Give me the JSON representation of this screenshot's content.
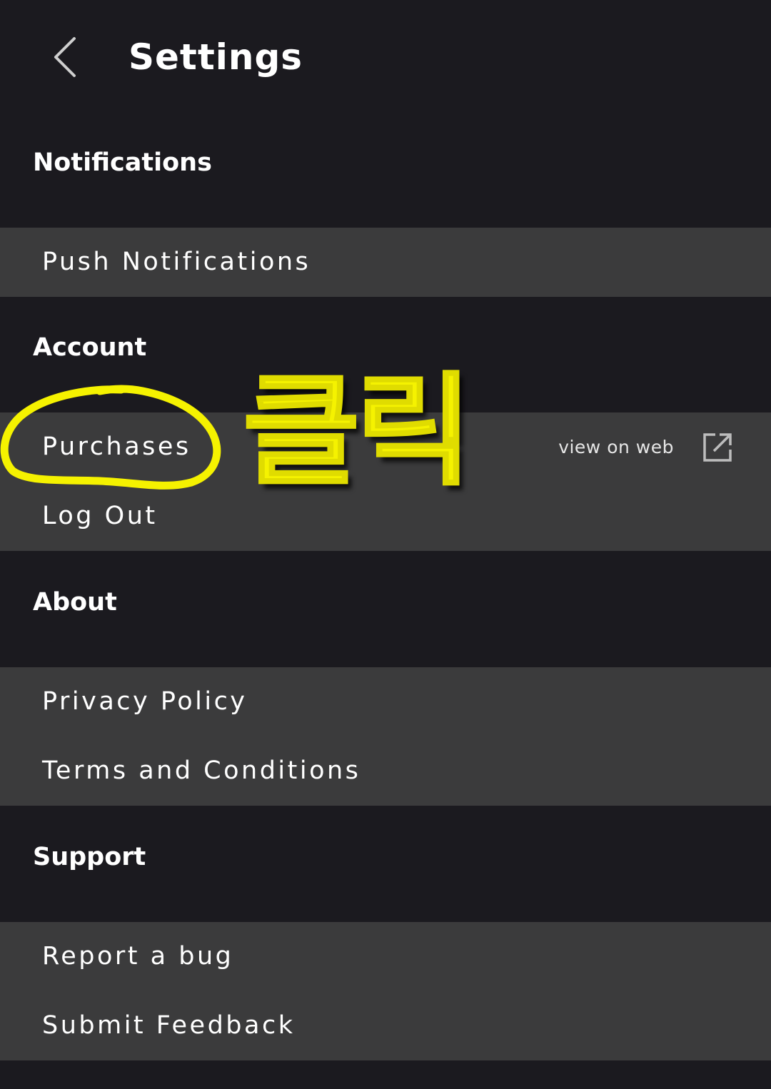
{
  "header": {
    "title": "Settings"
  },
  "sections": [
    {
      "title": "Notifications",
      "items": [
        {
          "label": "Push Notifications"
        }
      ]
    },
    {
      "title": "Account",
      "items": [
        {
          "label": "Purchases",
          "aside": "view on web"
        },
        {
          "label": "Log Out"
        }
      ]
    },
    {
      "title": "About",
      "items": [
        {
          "label": "Privacy Policy"
        },
        {
          "label": "Terms and Conditions"
        }
      ]
    },
    {
      "title": "Support",
      "items": [
        {
          "label": "Report a bug"
        },
        {
          "label": "Submit Feedback"
        }
      ]
    }
  ],
  "annotation": {
    "text": "클릭",
    "color": "#f5f200"
  },
  "colors": {
    "background": "#1b1a1f",
    "row_background": "#3b3b3c",
    "text": "#ffffff"
  },
  "icons": {
    "back": "chevron-left-icon",
    "external": "external-link-icon"
  }
}
